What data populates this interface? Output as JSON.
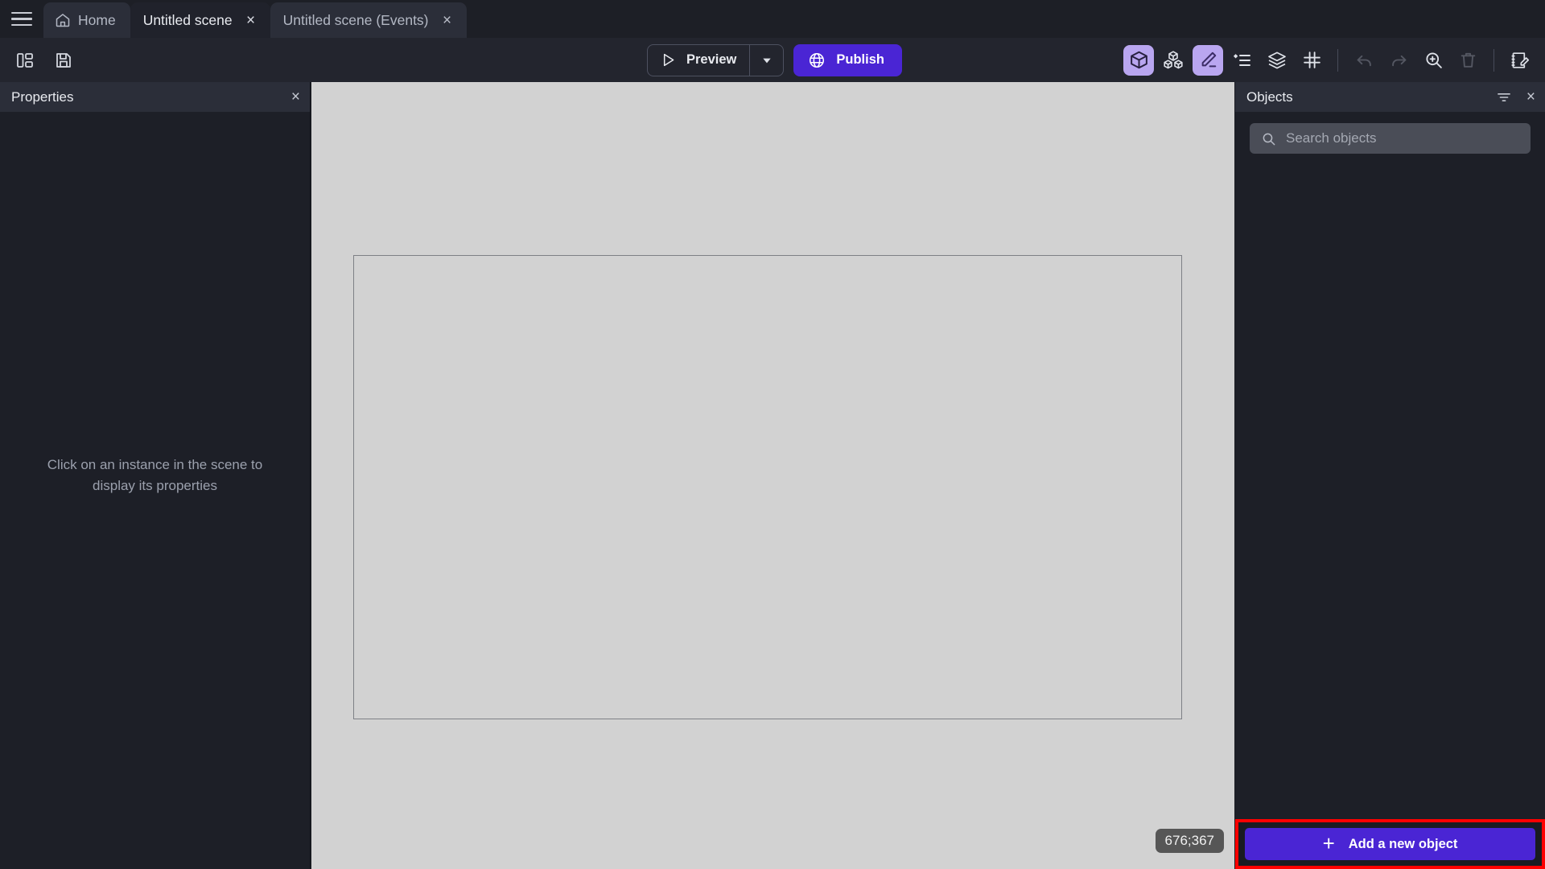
{
  "window": {
    "menu_icon": "hamburger-menu-icon"
  },
  "tabs": [
    {
      "label": "Home",
      "icon": "home-icon",
      "closable": false,
      "active": false
    },
    {
      "label": "Untitled scene",
      "icon": "",
      "closable": true,
      "active": true,
      "close_label": "×"
    },
    {
      "label": "Untitled scene (Events)",
      "icon": "",
      "closable": true,
      "active": false,
      "close_label": "×"
    }
  ],
  "toolbar": {
    "left_icons": [
      {
        "name": "layout-panels-icon"
      },
      {
        "name": "save-icon"
      }
    ],
    "preview_label": "Preview",
    "preview_icon": "play-triangle-icon",
    "preview_caret_icon": "chevron-down-icon",
    "publish_label": "Publish",
    "publish_icon": "globe-icon",
    "right_icons": [
      {
        "name": "cube-object-icon",
        "active": true,
        "disabled": false
      },
      {
        "name": "multiple-cubes-icon",
        "active": false,
        "disabled": false
      },
      {
        "name": "pencil-edit-icon",
        "active": true,
        "disabled": false
      },
      {
        "name": "properties-list-icon",
        "active": false,
        "disabled": false
      },
      {
        "name": "layers-icon",
        "active": false,
        "disabled": false
      },
      {
        "name": "grid-icon",
        "active": false,
        "disabled": false
      },
      {
        "name": "undo-icon",
        "active": false,
        "disabled": true
      },
      {
        "name": "redo-icon",
        "active": false,
        "disabled": true
      },
      {
        "name": "zoom-in-icon",
        "active": false,
        "disabled": false
      },
      {
        "name": "trash-delete-icon",
        "active": false,
        "disabled": true
      },
      {
        "name": "open-editor-icon",
        "active": false,
        "disabled": false
      }
    ]
  },
  "properties_panel": {
    "title": "Properties",
    "close_label": "×",
    "empty_message": "Click on an instance in the scene to display its properties"
  },
  "canvas": {
    "background_color": "#d2d2d2",
    "scene_border_color": "#7e8086",
    "coordinates": "676;367"
  },
  "objects_panel": {
    "title": "Objects",
    "filter_icon": "filter-icon",
    "close_label": "×",
    "search": {
      "placeholder": "Search objects",
      "value": "",
      "icon": "search-icon"
    },
    "add_button": {
      "label": "Add a new object",
      "icon": "plus-icon",
      "highlight_color": "#ff0000",
      "background_color": "#4a25d4"
    },
    "items": []
  },
  "colors": {
    "accent_purple": "#4a25d4",
    "icon_accent": "#b9a6f0",
    "highlight_red": "#ff0000",
    "panel_bg": "#1d1f27",
    "panel_header_bg": "#2b2e39",
    "toolbar_bg": "#23252e"
  }
}
